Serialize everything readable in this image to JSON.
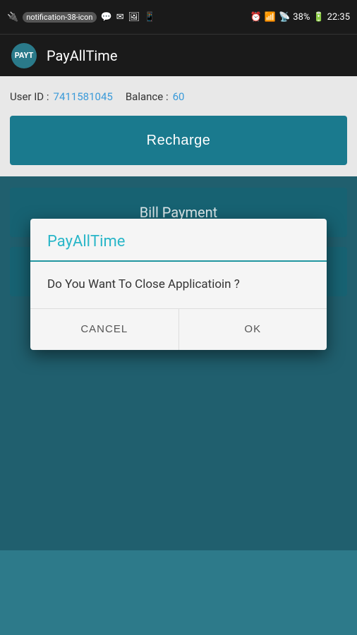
{
  "statusBar": {
    "icons_left": [
      "usb-icon",
      "notification-38-icon",
      "sms-icon",
      "mail-icon",
      "image-icon",
      "whatsapp-icon"
    ],
    "time": "22:35",
    "battery": "38%",
    "signal": "signal-icon"
  },
  "appBar": {
    "logoText": "PAYT",
    "title": "PayAllTime"
  },
  "userInfo": {
    "userIdLabel": "User ID :",
    "userId": "7411581045",
    "balanceLabel": "Balance :",
    "balance": "60"
  },
  "buttons": {
    "recharge": "Recharge",
    "billPayment": "Bill Payment",
    "thirdButton": ""
  },
  "dialog": {
    "title": "PayAllTime",
    "message": "Do You Want To Close Applicatioin ?",
    "cancelLabel": "CANCEL",
    "okLabel": "OK"
  }
}
